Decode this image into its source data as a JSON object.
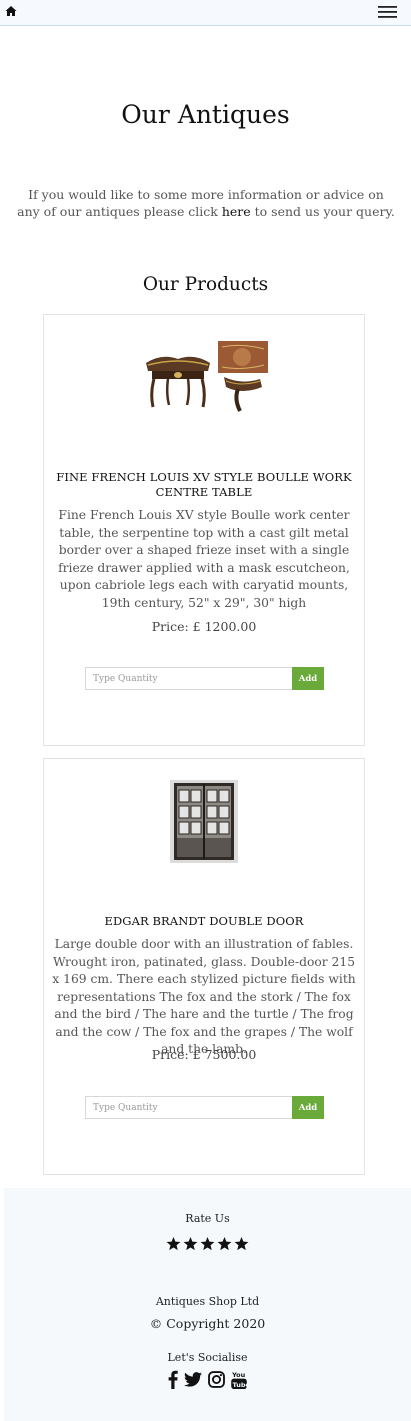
{
  "header": {
    "home_icon": "home-icon",
    "menu_icon": "hamburger-menu-icon"
  },
  "page": {
    "title": "Our Antiques",
    "intro_before": "If you would like to some more information or advice on any of our antiques please click ",
    "intro_link": "here",
    "intro_after": " to send us your query.",
    "section_title": "Our Products"
  },
  "products": [
    {
      "title": "Fine French Louis XV Style Boulle work centre table",
      "description": "Fine French Louis XV style Boulle work center table, the serpentine top with a cast gilt metal border over a shaped frieze inset with a single frieze drawer applied with a mask escutcheon, upon cabriole legs each with caryatid mounts, 19th century, 52\" x 29\", 30\" high",
      "price": "Price: £ 1200.00",
      "quantity_placeholder": "Type Quantity",
      "add_label": "Add"
    },
    {
      "title": "Edgar Brandt Double Door",
      "description": "Large double door with an illustration of fables. Wrought iron, patinated, glass. Double-door 215 x 169 cm. There each stylized picture fields with representations The fox and the stork / The fox and the bird / The hare and the turtle / The frog and the cow / The fox and the grapes / The wolf and the lamb.",
      "price": "Price: £ 7500.00",
      "quantity_placeholder": "Type Quantity",
      "add_label": "Add"
    }
  ],
  "footer": {
    "rate_label": "Rate Us",
    "rating": 5,
    "rating_max": 5,
    "company": "Antiques Shop Ltd",
    "copyright": "© Copyright 2020",
    "socialise_label": "Let's Socialise",
    "social_icons": [
      "facebook-icon",
      "twitter-icon",
      "instagram-icon",
      "youtube-icon"
    ]
  },
  "colors": {
    "add_button": "#6aaa3a",
    "footer_background": "#f5f9fc",
    "header_background": "#f6f9fd"
  }
}
